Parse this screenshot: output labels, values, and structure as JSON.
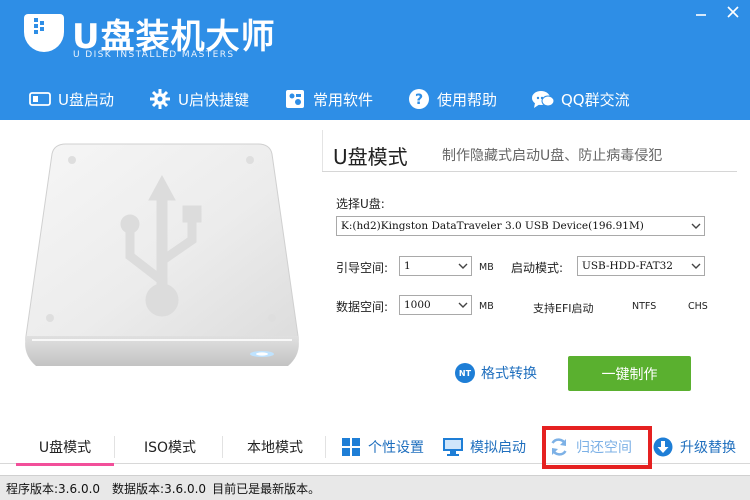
{
  "app": {
    "title": "U盘装机大师",
    "subtitle": "U DISK INSTALLED MASTERS"
  },
  "nav": {
    "items": [
      {
        "label": "U盘启动",
        "icon": "usb-drive-icon"
      },
      {
        "label": "U启快捷键",
        "icon": "gear-icon"
      },
      {
        "label": "常用软件",
        "icon": "software-icon"
      },
      {
        "label": "使用帮助",
        "icon": "help-icon"
      },
      {
        "label": "QQ群交流",
        "icon": "chat-icon"
      }
    ]
  },
  "mode": {
    "title": "U盘模式",
    "description": "制作隐藏式启动U盘、防止病毒侵犯"
  },
  "form": {
    "select_disk_label": "选择U盘:",
    "disk_value": "K:(hd2)Kingston DataTraveler 3.0 USB Device(196.91M)",
    "boot_space_label": "引导空间:",
    "boot_space_value": "1",
    "boot_space_unit": "MB",
    "boot_mode_label": "启动模式:",
    "boot_mode_value": "USB-HDD-FAT32",
    "data_space_label": "数据空间:",
    "data_space_value": "1000",
    "data_space_unit": "MB",
    "efi_label": "支持EFI启动",
    "ntfs_label": "NTFS",
    "chs_label": "CHS"
  },
  "actions": {
    "format_convert_badge": "NT",
    "format_convert_label": "格式转换",
    "one_click_label": "一键制作"
  },
  "tabs": [
    {
      "label": "U盘模式",
      "active": true
    },
    {
      "label": "ISO模式",
      "active": false
    },
    {
      "label": "本地模式",
      "active": false
    }
  ],
  "tools": {
    "personalize_label": "个性设置",
    "simulate_boot_label": "模拟启动",
    "restore_space_label": "归还空间",
    "upgrade_label": "升级替换"
  },
  "status": {
    "program_version": "程序版本:3.6.0.0",
    "data_version": "数据版本:3.6.0.0",
    "update_message": "目前已是最新版本。"
  },
  "colors": {
    "header": "#2e8ee6",
    "primary_button": "#5ab02f",
    "active_tab_underline": "#f24f9a",
    "link": "#1f6fbe",
    "highlight_box": "#e52121"
  }
}
